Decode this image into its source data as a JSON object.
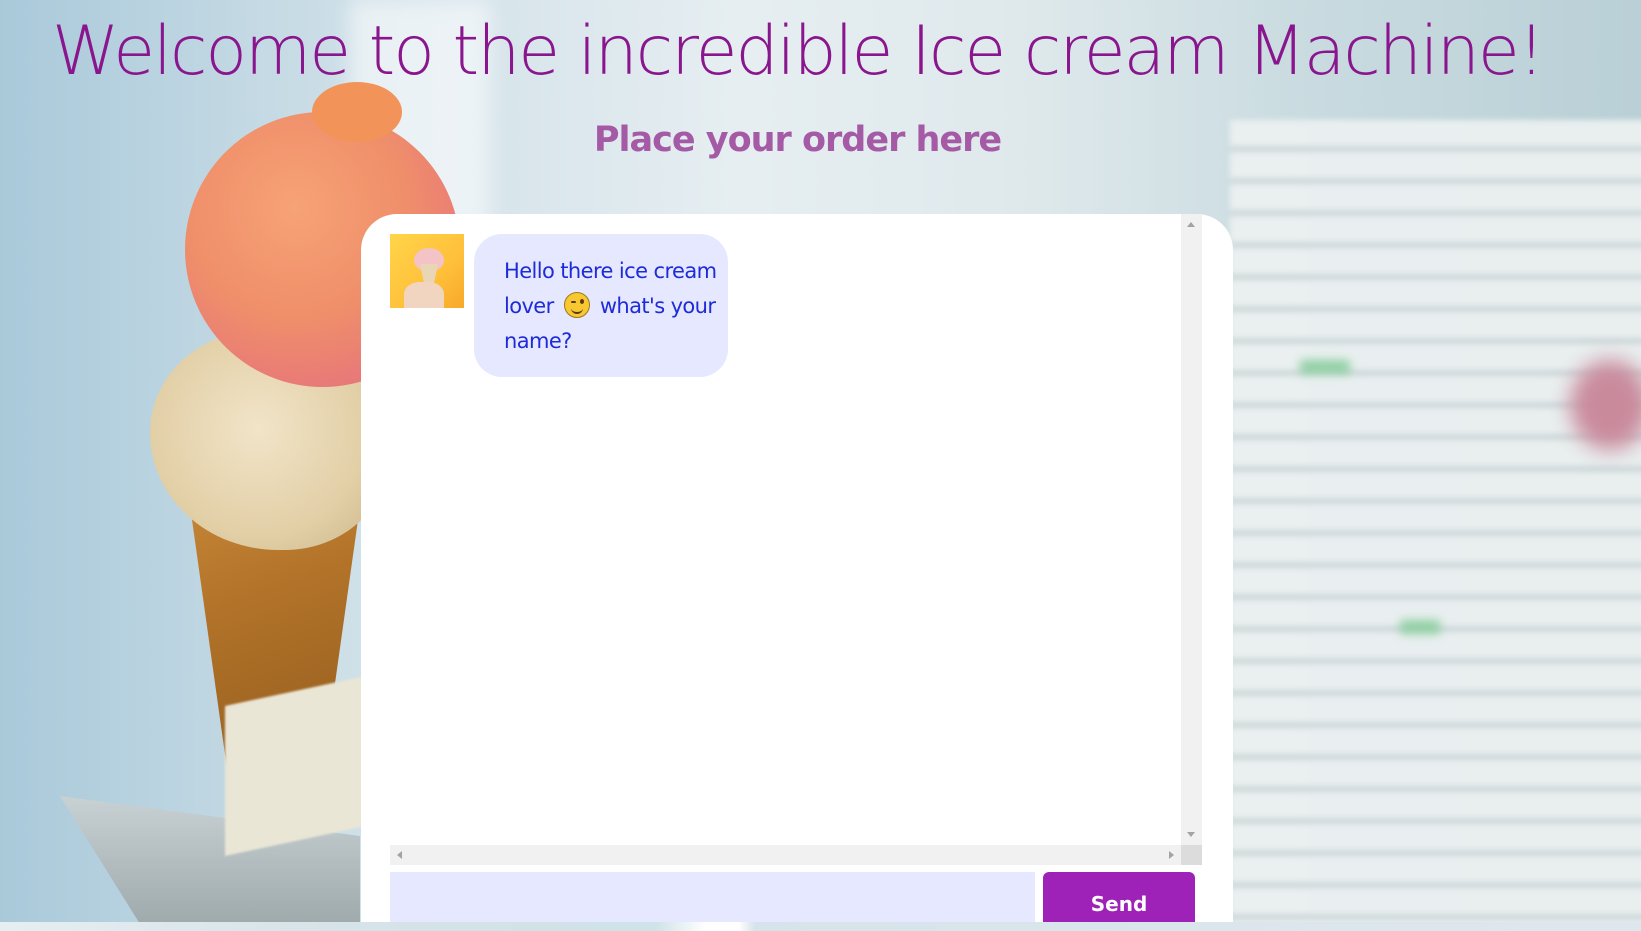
{
  "header": {
    "title": "Welcome to the incredible Ice cream Machine!",
    "subtitle": "Place your order here"
  },
  "chat": {
    "messages": [
      {
        "sender": "bot",
        "avatar_icon": "ice-cream-cone-photo",
        "text_before_emoji": "Hello there ice cream lover",
        "emoji": "winking-face-icon",
        "text_after_emoji": "what's your name?"
      }
    ]
  },
  "input": {
    "value": "",
    "placeholder": ""
  },
  "send_button": {
    "label": "Send"
  },
  "colors": {
    "title": "#8a168e",
    "subtitle": "#a55aa6",
    "bubble_background": "#e5e8ff",
    "bubble_text": "#1d2bd8",
    "send_button": "#9f22b8",
    "panel": "#ffffff"
  }
}
